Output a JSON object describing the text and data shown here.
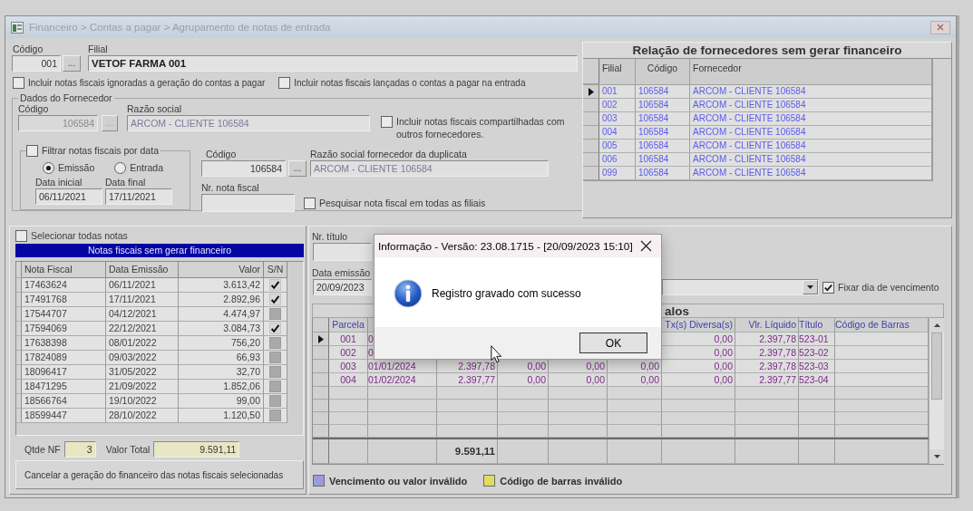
{
  "window": {
    "title": "Financeiro > Contas a pagar > Agrupamento de notas de entrada"
  },
  "filial": {
    "codigo_label": "Código",
    "codigo": "001",
    "lookup": "...",
    "filial_label": "Filial",
    "filial": "VETOF FARMA 001"
  },
  "options": [
    {
      "label": "Incluir notas fiscais ignoradas a geração do contas a pagar",
      "checked": false
    },
    {
      "label": "Incluir notas fiscais lançadas o contas a pagar na entrada",
      "checked": false
    }
  ],
  "fornecedor": {
    "title": "Dados do Fornecedor",
    "codigo_label": "Código",
    "codigo": {
      "value": "106584",
      "disabled": true
    },
    "lookup": {
      "label": "...",
      "disabled": true
    },
    "razao_label": "Razão social",
    "razao": "ARCOM - CLIENTE 106584",
    "compartilhadas": {
      "label": "Incluir notas fiscais compartilhadas com outros fornecedores.",
      "checked": false
    },
    "filtro": {
      "label": "Filtrar notas fiscais por data",
      "checked": false,
      "radios": [
        {
          "label": "Emissão",
          "selected": true
        },
        {
          "label": "Entrada",
          "selected": false
        }
      ],
      "data_inicial_label": "Data inicial",
      "data_inicial": "06/11/2021",
      "data_final_label": "Data final",
      "data_final": "17/11/2021"
    },
    "duplicata": {
      "codigo_label": "Código",
      "codigo": "106584",
      "lookup": "...",
      "razao_label": "Razão social fornecedor da duplicata",
      "razao": "ARCOM - CLIENTE 106584"
    },
    "nota_fiscal_label": "Nr. nota fiscal",
    "todas_filiais": {
      "label": "Pesquisar nota fiscal em todas as filiais",
      "checked": false
    }
  },
  "fornecedores": {
    "title": "Relação de fornecedores sem gerar financeiro",
    "columns": [
      "Filial",
      "Código",
      "Fornecedor"
    ],
    "rows": [
      {
        "filial": "001",
        "codigo": "106584",
        "fornecedor": "ARCOM - CLIENTE 106584",
        "selected": true
      },
      {
        "filial": "002",
        "codigo": "106584",
        "fornecedor": "ARCOM - CLIENTE 106584",
        "selected": false
      },
      {
        "filial": "003",
        "codigo": "106584",
        "fornecedor": "ARCOM - CLIENTE 106584",
        "selected": false
      },
      {
        "filial": "004",
        "codigo": "106584",
        "fornecedor": "ARCOM - CLIENTE 106584",
        "selected": false
      },
      {
        "filial": "005",
        "codigo": "106584",
        "fornecedor": "ARCOM - CLIENTE 106584",
        "selected": false
      },
      {
        "filial": "006",
        "codigo": "106584",
        "fornecedor": "ARCOM - CLIENTE 106584",
        "selected": false
      },
      {
        "filial": "099",
        "codigo": "106584",
        "fornecedor": "ARCOM - CLIENTE 106584",
        "selected": false
      }
    ]
  },
  "notas": {
    "select_all": {
      "label": "Selecionar todas notas",
      "checked": false
    },
    "title": "Notas fiscais sem gerar financeiro",
    "columns": [
      "Nota Fiscal",
      "Data Emissão",
      "Valor",
      "S/N"
    ],
    "rows": [
      {
        "nota_fiscal": "17463624",
        "data_emissao": "06/11/2021",
        "valor": "3.613,42",
        "checked": true
      },
      {
        "nota_fiscal": "17491768",
        "data_emissao": "17/11/2021",
        "valor": "2.892,96",
        "checked": true
      },
      {
        "nota_fiscal": "17544707",
        "data_emissao": "04/12/2021",
        "valor": "4.474,97",
        "checked": false
      },
      {
        "nota_fiscal": "17594069",
        "data_emissao": "22/12/2021",
        "valor": "3.084,73",
        "checked": true
      },
      {
        "nota_fiscal": "17638398",
        "data_emissao": "08/01/2022",
        "valor": "756,20",
        "checked": false
      },
      {
        "nota_fiscal": "17824089",
        "data_emissao": "09/03/2022",
        "valor": "66,93",
        "checked": false
      },
      {
        "nota_fiscal": "18096417",
        "data_emissao": "31/05/2022",
        "valor": "32,70",
        "checked": false
      },
      {
        "nota_fiscal": "18471295",
        "data_emissao": "21/09/2022",
        "valor": "1.852,06",
        "checked": false
      },
      {
        "nota_fiscal": "18566764",
        "data_emissao": "19/10/2022",
        "valor": "99,00",
        "checked": false
      },
      {
        "nota_fiscal": "18599447",
        "data_emissao": "28/10/2022",
        "valor": "1.120,50",
        "checked": false
      }
    ],
    "qtde_label": "Qtde NF",
    "qtde": "3",
    "total_label": "Valor Total",
    "total": "9.591,11",
    "cancel_button": "Cancelar a geração do financeiro das notas fiscais selecionadas"
  },
  "parcelas": {
    "nr_titulo_label": "Nr. título",
    "data_emissao_label": "Data emissão",
    "data_emissao": "20/09/2023",
    "fixar": {
      "label": "Fixar dia de vencimento",
      "checked": true
    },
    "title": "alos",
    "columns": {
      "parcela": "Parcela",
      "tx_diversas": "Tx(s) Diversa(s)",
      "vlr_liquido": "Vlr. Líquido",
      "titulo": "Título",
      "codigo_de_barras": "Código de Barras"
    },
    "rows": [
      {
        "selected": true,
        "cells": {
          "parcela": "001",
          "column_2": "0",
          "tx_diversas": "0,00",
          "vlr_liquido": "2.397,78",
          "titulo": "523-01"
        }
      },
      {
        "selected": false,
        "cells": {
          "parcela": "002",
          "column_2": "0",
          "tx_diversas": "0,00",
          "vlr_liquido": "2.397,78",
          "titulo": "523-02"
        }
      },
      {
        "selected": false,
        "cells": {
          "parcela": "003",
          "column_2": "01/01/2024",
          "column_3": "2.397,78",
          "column_4": "0,00",
          "column_5": "0,00",
          "column_6": "0,00",
          "tx_diversas": "0,00",
          "vlr_liquido": "2.397,78",
          "titulo": "523-03"
        }
      },
      {
        "selected": false,
        "cells": {
          "parcela": "004",
          "column_2": "01/02/2024",
          "column_3": "2.397,77",
          "column_4": "0,00",
          "column_5": "0,00",
          "column_6": "0,00",
          "tx_diversas": "0,00",
          "vlr_liquido": "2.397,77",
          "titulo": "523-04"
        }
      }
    ],
    "total": {
      "column_3": "9.591,11"
    },
    "legend": [
      {
        "label": "Vencimento ou valor inválido",
        "color": "#9a9ae0"
      },
      {
        "label": "Código de barras inválido",
        "color": "#e0dc60"
      }
    ]
  },
  "dialog": {
    "title": "Informação - Versão: 23.08.1715 - [20/09/2023 15:10]",
    "message": "Registro gravado com sucesso",
    "button": "OK"
  }
}
